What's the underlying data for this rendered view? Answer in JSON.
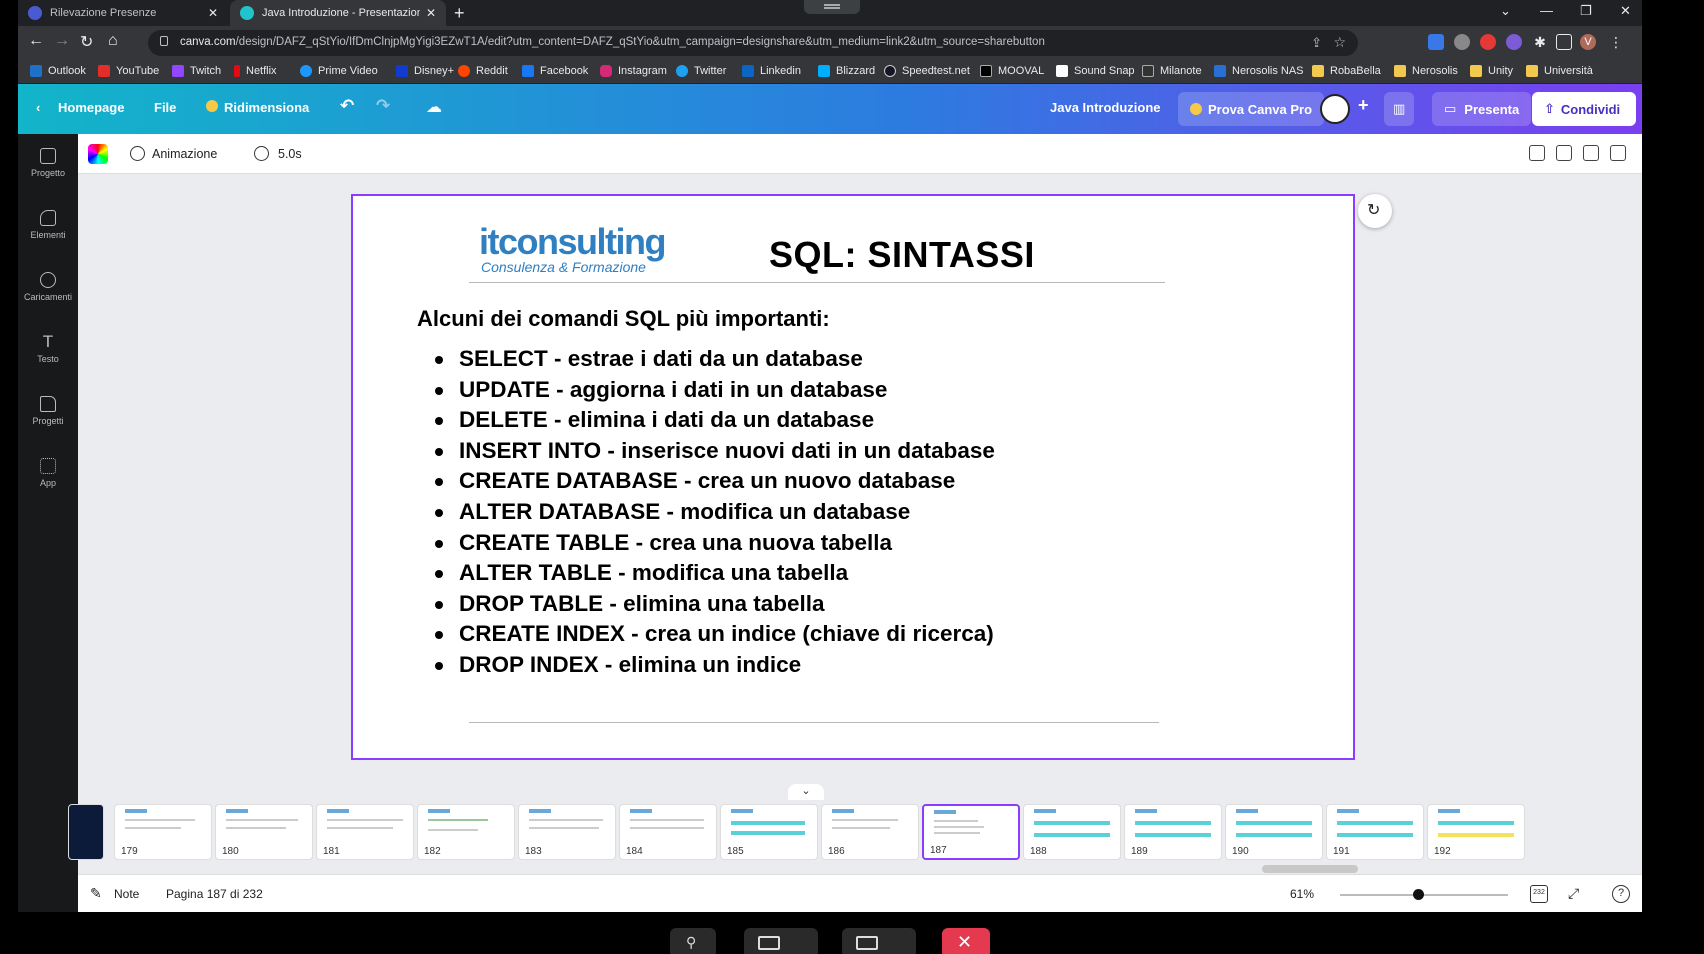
{
  "browser": {
    "tabs": [
      {
        "label": "Rilevazione Presenze",
        "active": false
      },
      {
        "label": "Java Introduzione - Presentazion",
        "active": true
      }
    ],
    "url_domain": "canva.com",
    "url_rest": "/design/DAFZ_qStYio/IfDmClnjpMgYigi3EZwT1A/edit?utm_content=DAFZ_qStYio&utm_campaign=designshare&utm_medium=link2&utm_source=sharebutton",
    "profile_initial": "V",
    "bookmarks": [
      "Outlook",
      "YouTube",
      "Twitch",
      "Netflix",
      "Prime Video",
      "Disney+",
      "Reddit",
      "Facebook",
      "Instagram",
      "Twitter",
      "Linkedin",
      "Blizzard",
      "Speedtest.net",
      "MOOVAL",
      "Sound Snap",
      "Milanote",
      "Nerosolis NAS",
      "RobaBella",
      "Nerosolis",
      "Unity",
      "Università"
    ]
  },
  "canva_header": {
    "home": "Homepage",
    "file": "File",
    "resize": "Ridimensiona",
    "doc_title": "Java Introduzione",
    "try_pro": "Prova Canva Pro",
    "present": "Presenta",
    "share": "Condividi"
  },
  "sidebar": {
    "items": [
      "Progetto",
      "Elementi",
      "Caricamenti",
      "Testo",
      "Progetti",
      "App"
    ]
  },
  "toolbar": {
    "animation": "Animazione",
    "duration": "5.0s"
  },
  "slide": {
    "logo_main": "itconsulting",
    "logo_sub": "Consulenza & Formazione",
    "title": "SQL: SINTASSI",
    "intro": "Alcuni dei comandi SQL più importanti:",
    "commands": [
      "SELECT - estrae i dati da un database",
      "UPDATE - aggiorna i dati in un database",
      "DELETE - elimina i dati da un database",
      "INSERT INTO - inserisce nuovi dati in un database",
      "CREATE DATABASE - crea un nuovo database",
      "ALTER DATABASE - modifica un database",
      "CREATE TABLE - crea una nuova tabella",
      "ALTER TABLE - modifica una tabella",
      "DROP TABLE - elimina una tabella",
      "CREATE INDEX - crea un indice (chiave di ricerca)",
      "DROP INDEX - elimina un indice"
    ]
  },
  "thumbnails": [
    "179",
    "180",
    "181",
    "182",
    "183",
    "184",
    "185",
    "186",
    "187",
    "188",
    "189",
    "190",
    "191",
    "192"
  ],
  "thumbnail_selected": "187",
  "statusbar": {
    "notes": "Note",
    "page_info": "Pagina 187 di 232",
    "zoom": "61%",
    "page_count_badge": "232"
  },
  "colors": {
    "selection": "#8b3dff",
    "logo_blue": "#2f7fc1",
    "header_start": "#12b5c9",
    "header_end": "#7a3ff0",
    "end_call": "#e53950"
  }
}
